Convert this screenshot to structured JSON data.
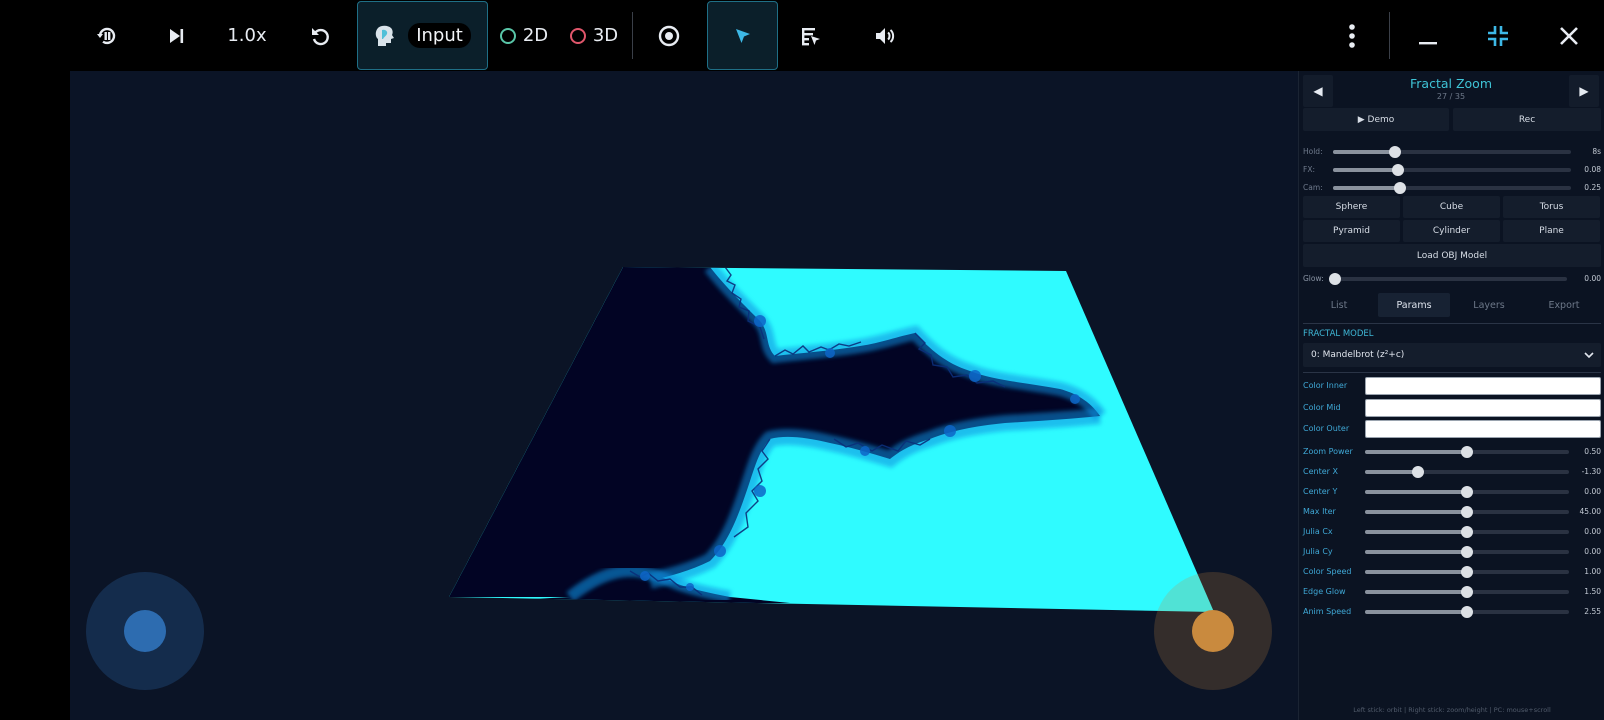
{
  "toolbar": {
    "speed": "1.0x",
    "input_label": "Input",
    "mode_2d": "2D",
    "mode_3d": "3D",
    "ring_2d_color": "#59c5a8",
    "ring_3d_color": "#e0566b"
  },
  "panel": {
    "title": "Fractal Zoom",
    "counter": "27 / 35",
    "prev": "◀",
    "next": "▶",
    "demo_label": "▶ Demo",
    "rec_label": "Rec",
    "top_sliders": [
      {
        "label": "Hold:",
        "value_text": "8s",
        "fraction": 0.26
      },
      {
        "label": "FX:",
        "value_text": "0.08",
        "fraction": 0.275
      },
      {
        "label": "Cam:",
        "value_text": "0.25",
        "fraction": 0.28
      }
    ],
    "shapes": [
      "Sphere",
      "Cube",
      "Torus",
      "Pyramid",
      "Cylinder",
      "Plane"
    ],
    "load_obj": "Load OBJ Model",
    "glow": {
      "label": "Glow:",
      "value_text": "0.00",
      "fraction": 0.0
    },
    "tabs": [
      {
        "label": "List",
        "active": false
      },
      {
        "label": "Params",
        "active": true
      },
      {
        "label": "Layers",
        "active": false
      },
      {
        "label": "Export",
        "active": false
      }
    ],
    "section": "FRACTAL MODEL",
    "model_select": "0: Mandelbrot (z²+c)",
    "colors": [
      {
        "label": "Color Inner"
      },
      {
        "label": "Color Mid"
      },
      {
        "label": "Color Outer"
      }
    ],
    "params": [
      {
        "label": "Zoom Power",
        "value_text": "0.50",
        "fraction": 0.5
      },
      {
        "label": "Center X",
        "value_text": "-1.30",
        "fraction": 0.26
      },
      {
        "label": "Center Y",
        "value_text": "0.00",
        "fraction": 0.5
      },
      {
        "label": "Max Iter",
        "value_text": "45.00",
        "fraction": 0.5
      },
      {
        "label": "Julia Cx",
        "value_text": "0.00",
        "fraction": 0.5
      },
      {
        "label": "Julia Cy",
        "value_text": "0.00",
        "fraction": 0.5
      },
      {
        "label": "Color Speed",
        "value_text": "1.00",
        "fraction": 0.5
      },
      {
        "label": "Edge Glow",
        "value_text": "1.50",
        "fraction": 0.5
      },
      {
        "label": "Anim Speed",
        "value_text": "2.55",
        "fraction": 0.5
      }
    ],
    "footer": "Left stick: orbit | Right stick: zoom/height | PC: mouse+scroll"
  },
  "viewport": {
    "bg_color": "#0b1426",
    "fractal_dark": "#020424",
    "fractal_light": "#2ffbff",
    "left_joystick_color": "#2d6cb0",
    "right_joystick_color": "#c98a3e"
  }
}
